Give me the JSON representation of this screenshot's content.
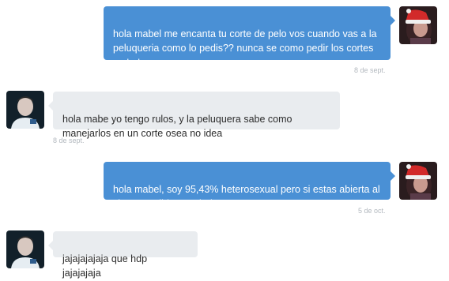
{
  "conversation": {
    "messages": [
      {
        "side": "sent",
        "text": "hola mabel me encanta tu corte de pelo vos cuando vas a la\npeluqueria como lo pedis?? nunca se como pedir los cortes\nmabel",
        "time": "8 de sept.",
        "avatar": "avatar-santa-hat-icon"
      },
      {
        "side": "received",
        "text": "hola mabe yo tengo rulos, y la peluquera sabe como\nmanejarlos en un corte osea no idea",
        "time": "8 de sept.",
        "avatar": "avatar-person-icon"
      },
      {
        "side": "sent",
        "text": "hola mabel, soy 95,43% heterosexual pero si estas abierta al\ncierre escribime mabel",
        "time": "5 de oct.",
        "avatar": "avatar-santa-hat-icon"
      },
      {
        "side": "received",
        "text": "jajajajajaja que hdp jajajajaja",
        "time": "",
        "avatar": "avatar-person-icon"
      }
    ]
  },
  "colors": {
    "sent_bubble": "#4a90d5",
    "received_bubble": "#e9ecef",
    "timestamp": "#b3b9bf",
    "background": "#ffffff"
  }
}
